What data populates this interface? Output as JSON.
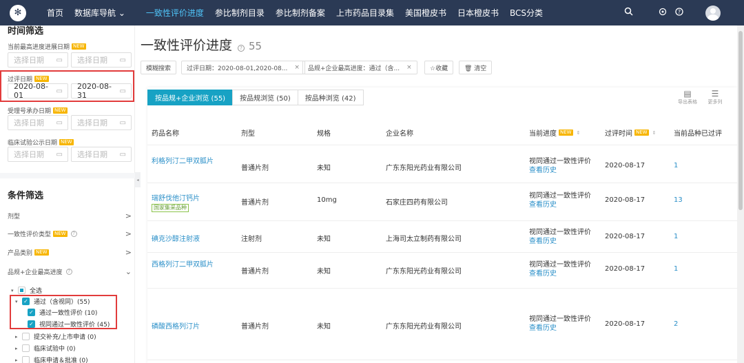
{
  "nav": {
    "logo": "✻",
    "items": [
      "首页",
      "数据库导航 ⌄",
      "一致性评价进度",
      "参比制剂目录",
      "参比制剂备案",
      "上市药品目录集",
      "美国橙皮书",
      "日本橙皮书",
      "BCS分类"
    ],
    "active_index": 2,
    "icons": [
      "search-icon",
      "gift-icon",
      "help-icon"
    ]
  },
  "sidebar": {
    "time_title": "时间筛选",
    "new_badge": "NEW",
    "date_filters": [
      {
        "label": "当前最高进度进展日期",
        "start": "选择日期",
        "end": "选择日期",
        "filled": false
      },
      {
        "label": "过评日期",
        "start": "2020-08-01",
        "end": "2020-08-31",
        "filled": true
      },
      {
        "label": "受理号承办日期",
        "start": "选择日期",
        "end": "选择日期",
        "filled": false
      },
      {
        "label": "临床试验公示日期",
        "start": "选择日期",
        "end": "选择日期",
        "filled": false
      }
    ],
    "cond_title": "条件筛选",
    "conditions": [
      {
        "label": "剂型",
        "badge": false,
        "help": false,
        "chev": ">"
      },
      {
        "label": "一致性评价类型",
        "badge": true,
        "help": true,
        "chev": ">"
      },
      {
        "label": "产品类别",
        "badge": true,
        "help": false,
        "chev": ">"
      },
      {
        "label": "品规+企业最高进度",
        "badge": false,
        "help": true,
        "chev": "⌄"
      }
    ],
    "tree": [
      {
        "label": "全选",
        "level": 0,
        "state": "partial",
        "tri": "▾"
      },
      {
        "label": "通过（含视同）(55)",
        "level": 1,
        "state": "checked",
        "tri": "▾"
      },
      {
        "label": "通过一致性评价 (10)",
        "level": 2,
        "state": "checked",
        "tri": ""
      },
      {
        "label": "视同通过一致性评价 (45)",
        "level": 2,
        "state": "checked",
        "tri": ""
      },
      {
        "label": "提交补充/上市申请 (0)",
        "level": 1,
        "state": "empty",
        "tri": "▸"
      },
      {
        "label": "临床试验中 (0)",
        "level": 1,
        "state": "empty",
        "tri": "▸"
      },
      {
        "label": "临床申请＆批准 (0)",
        "level": 1,
        "state": "empty",
        "tri": "▸"
      }
    ]
  },
  "main": {
    "title": "一致性评价进度",
    "count": "55",
    "tags": [
      {
        "text": "模糊搜索",
        "close": false
      },
      {
        "text": "过评日期：2020-08-01,2020-08...",
        "close": true
      },
      {
        "text": "品规+企业最高进度：通过（含...",
        "close": true
      },
      {
        "text": "☆收藏",
        "close": false
      },
      {
        "text": "🗑 清空",
        "close": false
      }
    ],
    "tabs": [
      "按品规+企业浏览 (55)",
      "按品规浏览 (50)",
      "按品种浏览 (42)"
    ],
    "tools": [
      {
        "icon": "▤",
        "label": "导出表格"
      },
      {
        "icon": "☰",
        "label": "更多列"
      }
    ],
    "columns": [
      "药品名称",
      "剂型",
      "规格",
      "企业名称",
      "当前进度",
      "过评时间",
      "当前品种已过评"
    ],
    "rows": [
      {
        "drug": "利格列汀二甲双胍片",
        "form": "普通片剂",
        "spec": "未知",
        "company": "广东东阳光药业有限公司",
        "progress": "视同通过一致性评价",
        "history": "查看历史",
        "date": "2020-08-17",
        "count": "1",
        "tag": ""
      },
      {
        "drug": "瑞舒伐他汀钙片",
        "form": "普通片剂",
        "spec": "10mg",
        "company": "石家庄四药有限公司",
        "progress": "视同通过一致性评价",
        "history": "查看历史",
        "date": "2020-08-17",
        "count": "13",
        "tag": "国家集采品种"
      },
      {
        "drug": "碘克沙醇注射液",
        "form": "注射剂",
        "spec": "未知",
        "company": "上海司太立制药有限公司",
        "progress": "视同通过一致性评价",
        "history": "查看历史",
        "date": "2020-08-17",
        "count": "1",
        "tag": ""
      },
      {
        "drug": "西格列汀二甲双胍片",
        "form": "普通片剂",
        "spec": "未知",
        "company": "广东东阳光药业有限公司",
        "progress": "视同通过一致性评价",
        "history": "查看历史",
        "date": "2020-08-17",
        "count": "1",
        "tag": ""
      },
      {
        "drug": "磷酸西格列汀片",
        "form": "普通片剂",
        "spec": "未知",
        "company": "广东东阳光药业有限公司",
        "progress": "视同通过一致性评价",
        "history": "查看历史",
        "date": "2020-08-17",
        "count": "2",
        "tag": ""
      }
    ]
  }
}
